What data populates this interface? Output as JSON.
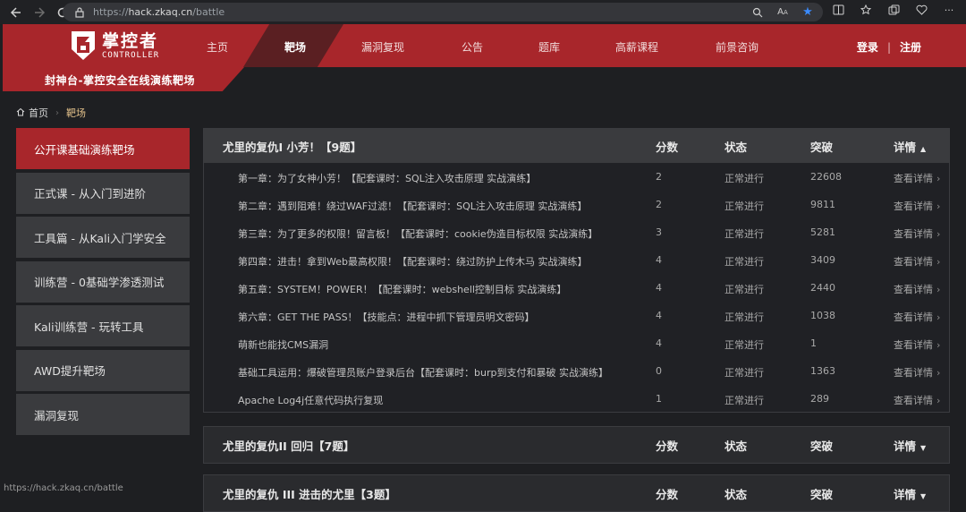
{
  "browser": {
    "url_scheme": "https://",
    "url_host": "hack.zkaq.cn",
    "url_path": "/battle",
    "zoom_icon": "zoom-icon",
    "read_aloud": "A ",
    "status_url": "https://hack.zkaq.cn/battle"
  },
  "brand": {
    "name_cn": "掌控者",
    "name_en": "CONTROLLER",
    "subtitle": "封神台-掌控安全在线演练靶场",
    "accent": "#a8262b"
  },
  "nav": {
    "items": [
      "主页",
      "靶场",
      "漏洞复现",
      "公告",
      "题库",
      "高薪课程",
      "前景咨询"
    ],
    "active": "靶场",
    "login": "登录",
    "register": "注册",
    "sep": "|"
  },
  "breadcrumb": {
    "home": "首页",
    "current": "靶场"
  },
  "sidebar": {
    "items": [
      "公开课基础演练靶场",
      "正式课 - 从入门到进阶",
      "工具篇 - 从Kali入门学安全",
      "训练营 - 0基础学渗透测试",
      "Kali训练营 - 玩转工具",
      "AWD提升靶场",
      "漏洞复现"
    ],
    "active_index": 0
  },
  "table": {
    "headers": {
      "score": "分数",
      "state": "状态",
      "break": "突破",
      "detail": "详情"
    },
    "link_text": "查看详情",
    "panels": [
      {
        "title": "尤里的复仇Ⅰ 小芳！【9题】",
        "expanded": true,
        "rows": [
          {
            "name": "第一章：为了女神小芳！【配套课时：SQL注入攻击原理 实战演练】",
            "score": "2",
            "state": "正常进行",
            "break": "22608"
          },
          {
            "name": "第二章：遇到阻难！绕过WAF过滤！【配套课时：SQL注入攻击原理 实战演练】",
            "score": "2",
            "state": "正常进行",
            "break": "9811"
          },
          {
            "name": "第三章：为了更多的权限！留言板！【配套课时：cookie伪造目标权限 实战演练】",
            "score": "3",
            "state": "正常进行",
            "break": "5281"
          },
          {
            "name": "第四章：进击！拿到Web最高权限！【配套课时：绕过防护上传木马 实战演练】",
            "score": "4",
            "state": "正常进行",
            "break": "3409"
          },
          {
            "name": "第五章：SYSTEM！POWER！【配套课时：webshell控制目标 实战演练】",
            "score": "4",
            "state": "正常进行",
            "break": "2440"
          },
          {
            "name": "第六章：GET THE PASS！【技能点：进程中抓下管理员明文密码】",
            "score": "4",
            "state": "正常进行",
            "break": "1038"
          },
          {
            "name": "萌新也能找CMS漏洞",
            "score": "4",
            "state": "正常进行",
            "break": "1"
          },
          {
            "name": "基础工具运用：爆破管理员账户登录后台【配套课时：burp到支付和暴破 实战演练】",
            "score": "0",
            "state": "正常进行",
            "break": "1363"
          },
          {
            "name": "Apache Log4j任意代码执行复现",
            "score": "1",
            "state": "正常进行",
            "break": "289"
          }
        ]
      },
      {
        "title": "尤里的复仇II 回归【7题】",
        "expanded": false,
        "rows": []
      },
      {
        "title": "尤里的复仇 III 进击的尤里【3题】",
        "expanded": false,
        "rows": []
      }
    ]
  }
}
